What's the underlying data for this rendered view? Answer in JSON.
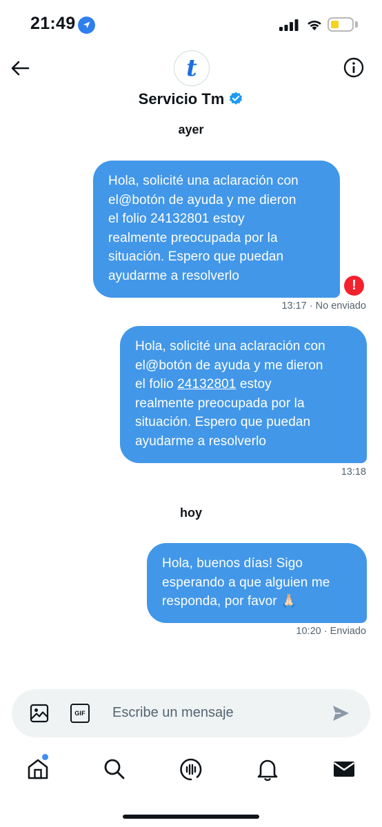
{
  "status_bar": {
    "time": "21:49"
  },
  "header": {
    "title": "Servicio Tm",
    "avatar_letter": "t"
  },
  "conversation": {
    "day_1": "ayer",
    "day_2": "hoy",
    "messages": [
      {
        "lines": [
          "Hola, solicité una aclaración con",
          "el@botón de ayuda y me dieron",
          "el folio 24132801 estoy",
          "realmente preocupada por la",
          "situación. Espero que puedan",
          "ayudarme a resolverlo"
        ],
        "time": "13:17",
        "status": "· No enviado"
      },
      {
        "line_1": "Hola, solicité una aclaración con",
        "line_2": "el@botón de ayuda y me dieron",
        "line_3_prefix": "el folio ",
        "line_3_link": "24132801",
        "line_3_suffix": " estoy",
        "line_4": "realmente preocupada por la",
        "line_5": "situación. Espero que puedan",
        "line_6": "ayudarme a resolverlo",
        "time": "13:18",
        "status": ""
      },
      {
        "lines": [
          "Hola, buenos días! Sigo",
          "esperando a que alguien me",
          "responda, por favor 🙏🏻"
        ],
        "time": "10:20",
        "status": "· Enviado"
      }
    ]
  },
  "composer": {
    "placeholder": "Escribe un mensaje",
    "gif_label": "GIF"
  },
  "tabs": [
    "home-icon",
    "search-icon",
    "spaces-icon",
    "notifications-icon",
    "messages-icon"
  ],
  "colors": {
    "bubble": "#4297e8",
    "accent": "#1d9bf0",
    "error": "#f4212e"
  }
}
